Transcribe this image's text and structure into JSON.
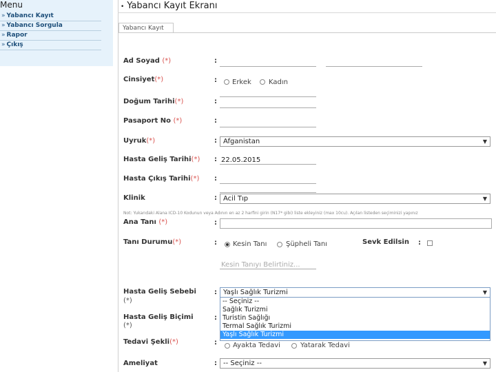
{
  "sidebar": {
    "title": "Menu",
    "items": [
      {
        "label": "Yabancı Kayıt"
      },
      {
        "label": "Yabancı Sorgula"
      },
      {
        "label": "Rapor"
      },
      {
        "label": "Çıkış"
      }
    ],
    "arrow": "»"
  },
  "header": {
    "title": "Yabancı Kayıt Ekranı",
    "bullet": "•"
  },
  "tab": {
    "label": "Yabancı Kayıt"
  },
  "form": {
    "colon": ":",
    "required_mark": "(*)",
    "ad_soyad": {
      "label": "Ad Soyad",
      "ad_value": "",
      "soyad_value": ""
    },
    "cinsiyet": {
      "label": "Cinsiyet",
      "options": [
        "Erkek",
        "Kadın"
      ]
    },
    "dogum_tarihi": {
      "label": "Doğum Tarihi",
      "value": ""
    },
    "pasaport_no": {
      "label": "Pasaport No",
      "value": ""
    },
    "uyruk": {
      "label": "Uyruk",
      "selected": "Afganistan"
    },
    "hasta_gelis_tarihi": {
      "label": "Hasta Geliş Tarihi",
      "value": "22.05.2015"
    },
    "hasta_cikis_tarihi": {
      "label": "Hasta Çıkış Tarihi",
      "value": ""
    },
    "klinik": {
      "label": "Klinik",
      "selected": "Acil Tıp"
    },
    "note": "Not: Yukarıdaki Alana ICD-10 Kodunun veya Adının en az 2 harfini girin (N17* gibi) liste ekleyiniz (max 10cu). Açılan listeden seçiminizi yapınız",
    "ana_tani": {
      "label": "Ana Tanı",
      "value": ""
    },
    "tani_durumu": {
      "label": "Tanı Durumu",
      "options": [
        "Kesin Tanı",
        "Şüpheli Tanı"
      ],
      "placeholder": "Kesin Tanıyı Belirtiniz..."
    },
    "sevk_edilsin": {
      "label": "Sevk Edilsin"
    },
    "hasta_gelis_sebebi": {
      "label": "Hasta Geliş Sebebi",
      "selected": "Yaşlı Sağlık Turizmi",
      "options": [
        "-- Seçiniz --",
        "Sağlık Turizmi",
        "Turistin Sağlığı",
        "Termal Sağlık Turizmi",
        "Yaşlı Sağlık Turizmi"
      ]
    },
    "hasta_gelis_bicimi": {
      "label": "Hasta Geliş Biçimi"
    },
    "tedavi_sekli": {
      "label": "Tedavi Şekli",
      "options": [
        "Ayakta Tedavi",
        "Yatarak Tedavi"
      ]
    },
    "ameliyat": {
      "label": "Ameliyat",
      "selected": "-- Seçiniz --"
    },
    "caret": "▼"
  }
}
